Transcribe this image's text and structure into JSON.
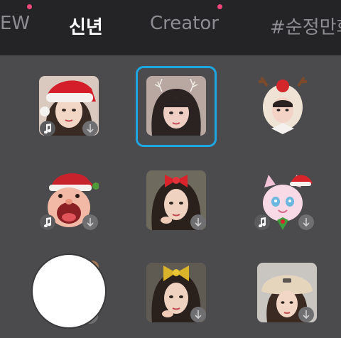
{
  "tabs": [
    {
      "label": "EW",
      "active": false
    },
    {
      "label": "신년",
      "active": true
    },
    {
      "label": "Creator",
      "active": false
    },
    {
      "label": "#순정만화",
      "active": false
    }
  ],
  "colors": {
    "accent_dot": "#f0487a",
    "selection": "#1ea6e0",
    "background": "#4b4b4d",
    "topbar": "#242426"
  },
  "filters": [
    {
      "name": "santa-hat-girl",
      "music": true,
      "download": true
    },
    {
      "name": "antler-sparkle-girl",
      "music": false,
      "download": false,
      "selected": true
    },
    {
      "name": "reindeer-hood-girl",
      "music": false,
      "download": false
    },
    {
      "name": "santa-cartoon-man",
      "music": true,
      "download": true
    },
    {
      "name": "red-bow-girl",
      "music": false,
      "download": true
    },
    {
      "name": "pink-cat-santa",
      "music": true,
      "download": true
    },
    {
      "name": "bear-ears-item",
      "music": false,
      "download": true
    },
    {
      "name": "gold-bow-girl",
      "music": false,
      "download": true
    },
    {
      "name": "bucket-hat-girl",
      "music": false,
      "download": true
    }
  ],
  "icons": {
    "music": "music-note-icon",
    "download": "download-arrow-icon"
  }
}
